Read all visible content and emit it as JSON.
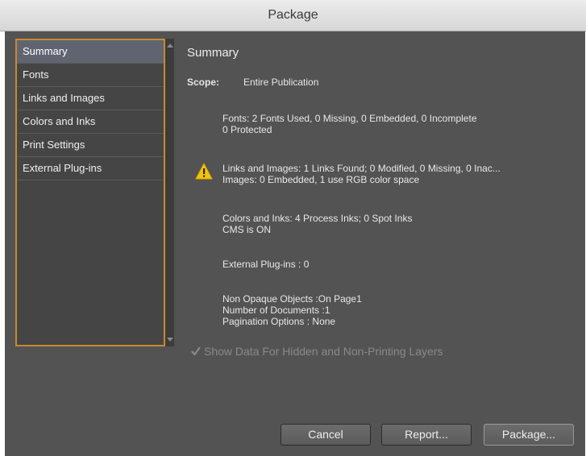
{
  "window": {
    "title": "Package"
  },
  "sidebar": {
    "items": [
      {
        "label": "Summary"
      },
      {
        "label": "Fonts"
      },
      {
        "label": "Links and Images"
      },
      {
        "label": "Colors and Inks"
      },
      {
        "label": "Print Settings"
      },
      {
        "label": "External Plug-ins"
      }
    ],
    "selected_index": 0
  },
  "summary": {
    "heading": "Summary",
    "scope_label": "Scope:",
    "scope_value": "Entire Publication",
    "fonts_line1": "Fonts: 2 Fonts Used, 0 Missing, 0 Embedded, 0 Incomplete",
    "fonts_line2": "0 Protected",
    "links_line1": "Links and Images: 1 Links Found; 0 Modified, 0 Missing, 0 Inac...",
    "links_line2": "Images: 0 Embedded, 1 use RGB color space",
    "links_warning_icon": "warning-triangle-icon",
    "colors_line1": "Colors and Inks: 4 Process Inks; 0 Spot Inks",
    "colors_line2": "CMS is ON",
    "plugins_line": "External Plug-ins : 0",
    "other_line1": "Non Opaque Objects :On Page1",
    "other_line2": "Number of Documents :1",
    "other_line3": "Pagination Options : None"
  },
  "options": {
    "show_hidden_label": "Show Data For Hidden and Non-Printing Layers",
    "show_hidden_checked": true,
    "show_hidden_enabled": false
  },
  "buttons": {
    "cancel": "Cancel",
    "report": "Report...",
    "package": "Package..."
  },
  "colors": {
    "dialog_bg": "#535353",
    "list_focus_border": "#c88a2d",
    "warning": "#f5c400"
  }
}
